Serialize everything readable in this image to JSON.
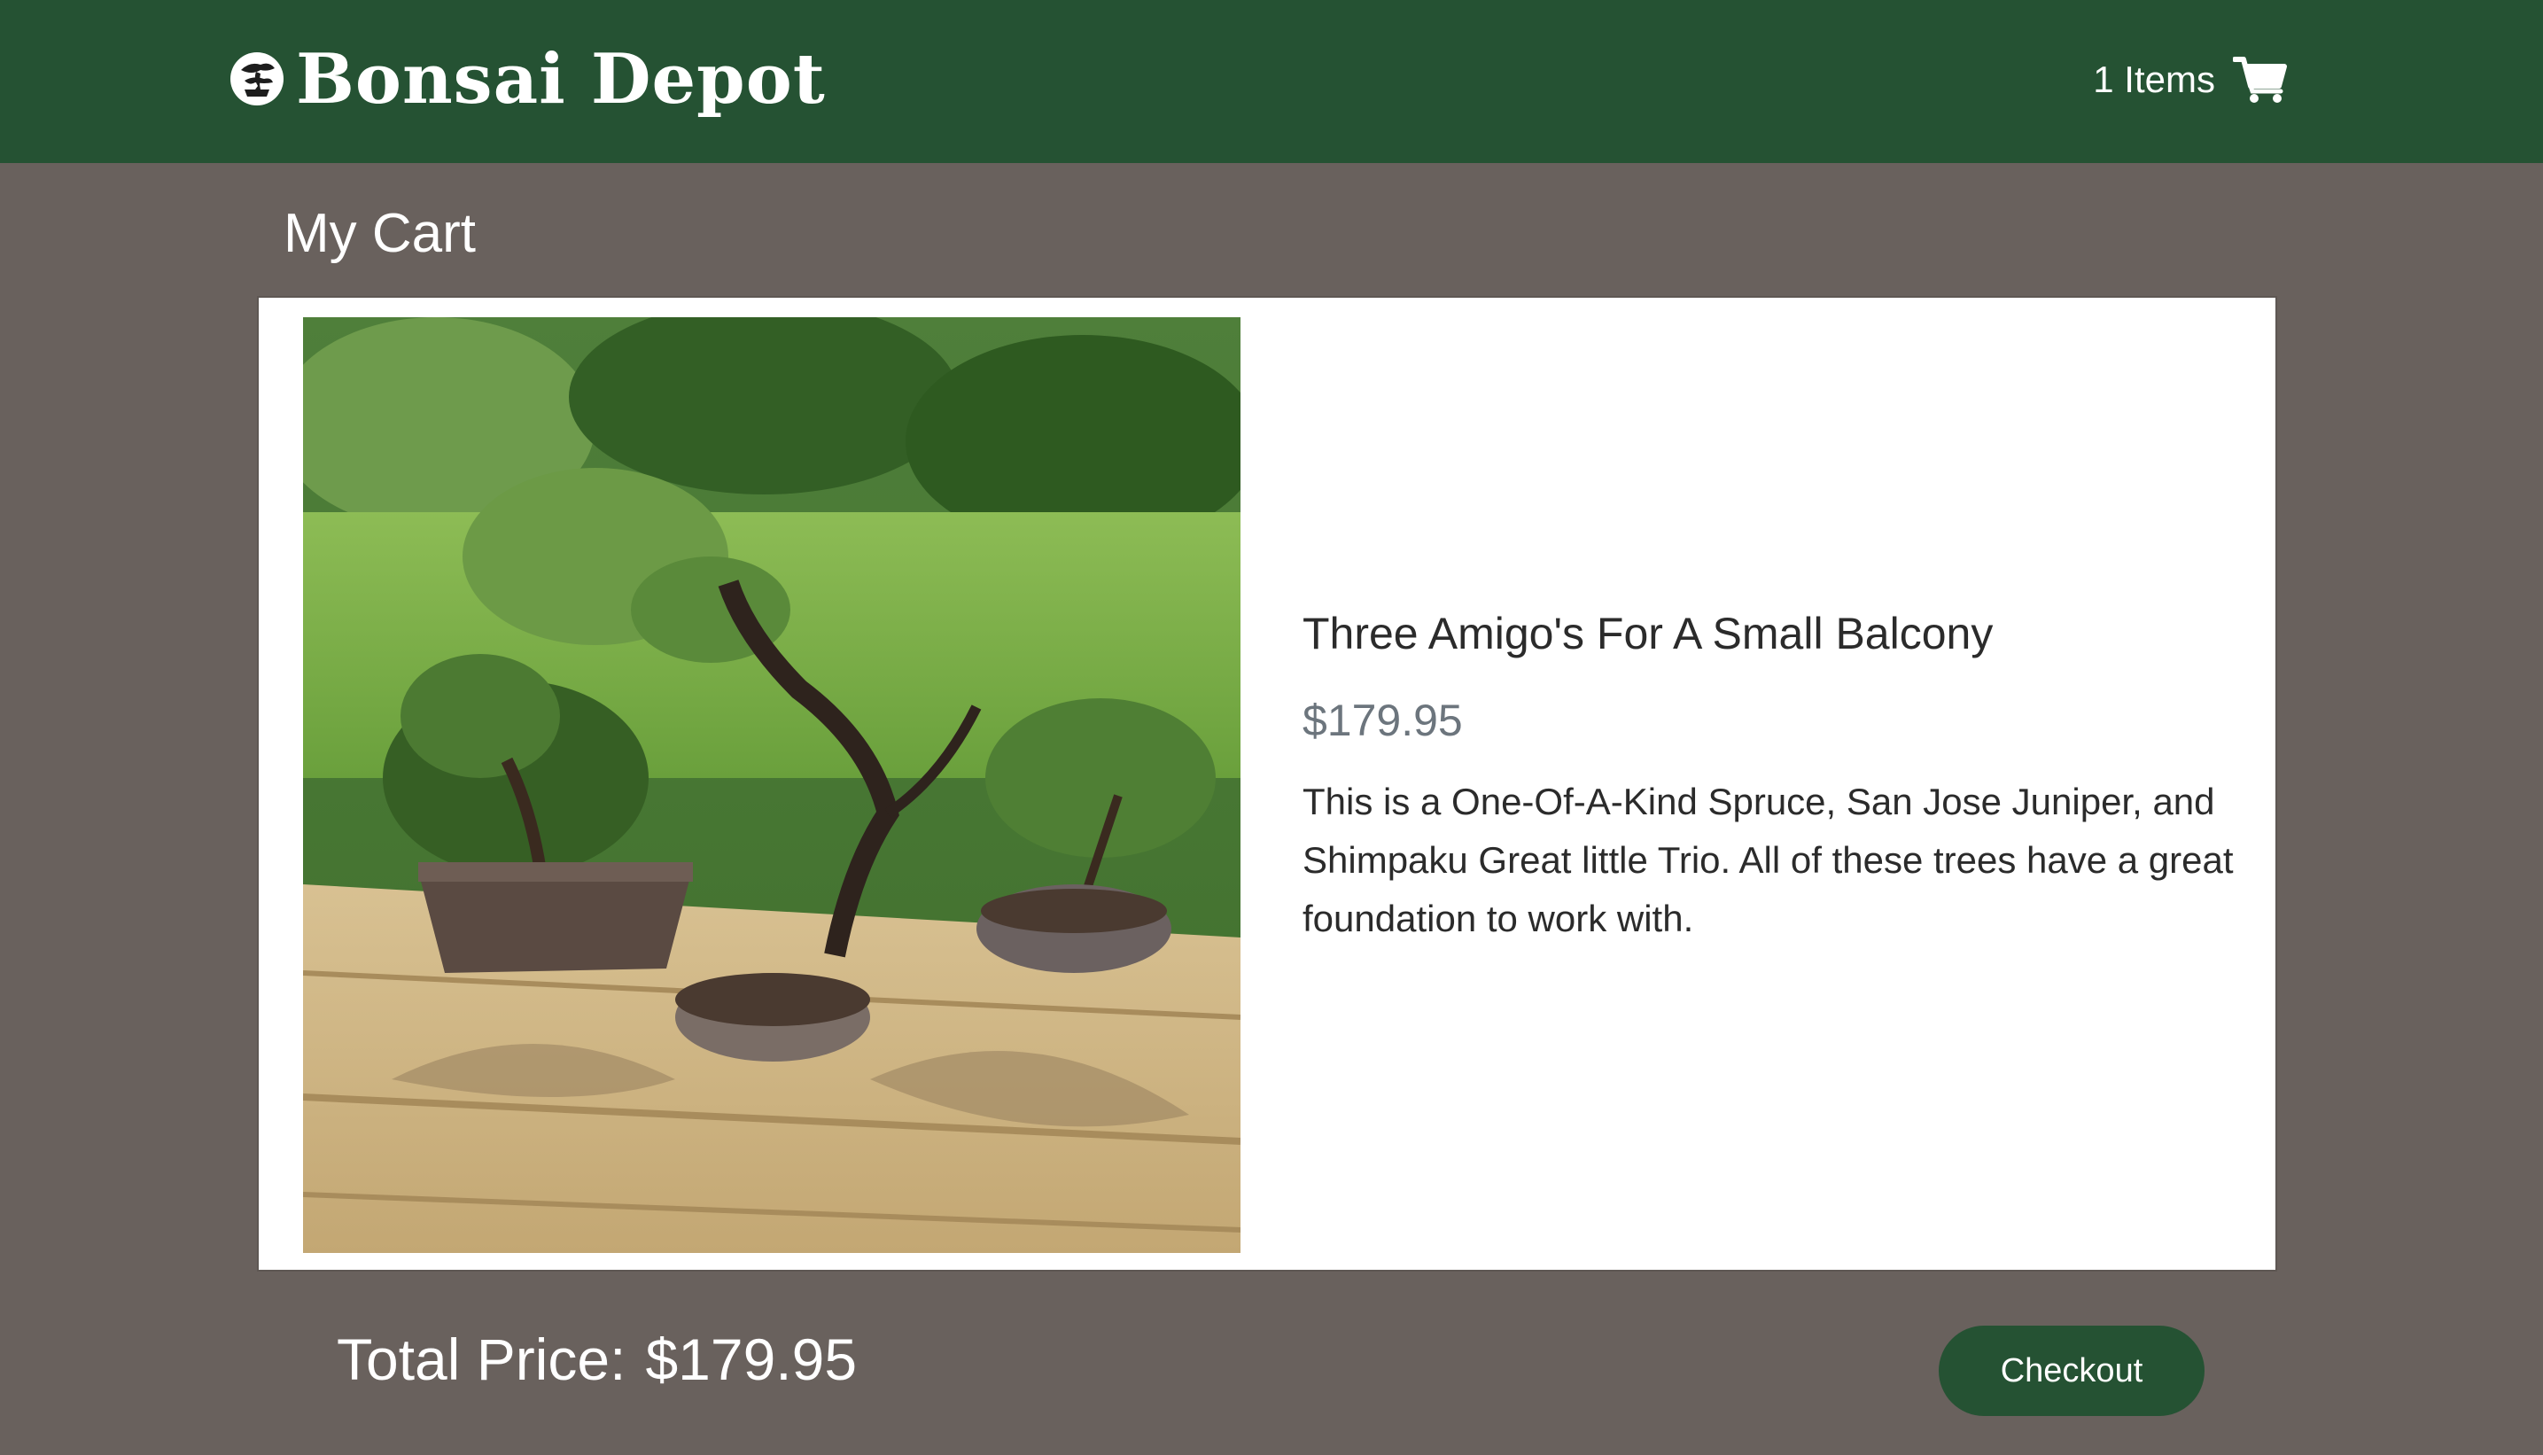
{
  "brand": {
    "name": "Bonsai Depot",
    "logo_icon": "bonsai-logo-icon"
  },
  "nav": {
    "cart_count": "1 Items",
    "cart_icon": "shopping-cart-icon"
  },
  "page": {
    "title": "My Cart"
  },
  "cart": {
    "items": [
      {
        "name": "Three Amigo's For A Small Balcony",
        "price": "$179.95",
        "description": "This is a One-Of-A-Kind Spruce, San Jose Juniper, and Shimpaku Great little Trio. All of these trees have a great foundation to work with."
      }
    ]
  },
  "summary": {
    "total_label": "Total Price:",
    "total_value": "$179.95",
    "checkout_label": "Checkout"
  },
  "colors": {
    "header": "#255233",
    "background": "#69615d",
    "button": "#255233",
    "price": "#6c757d"
  }
}
